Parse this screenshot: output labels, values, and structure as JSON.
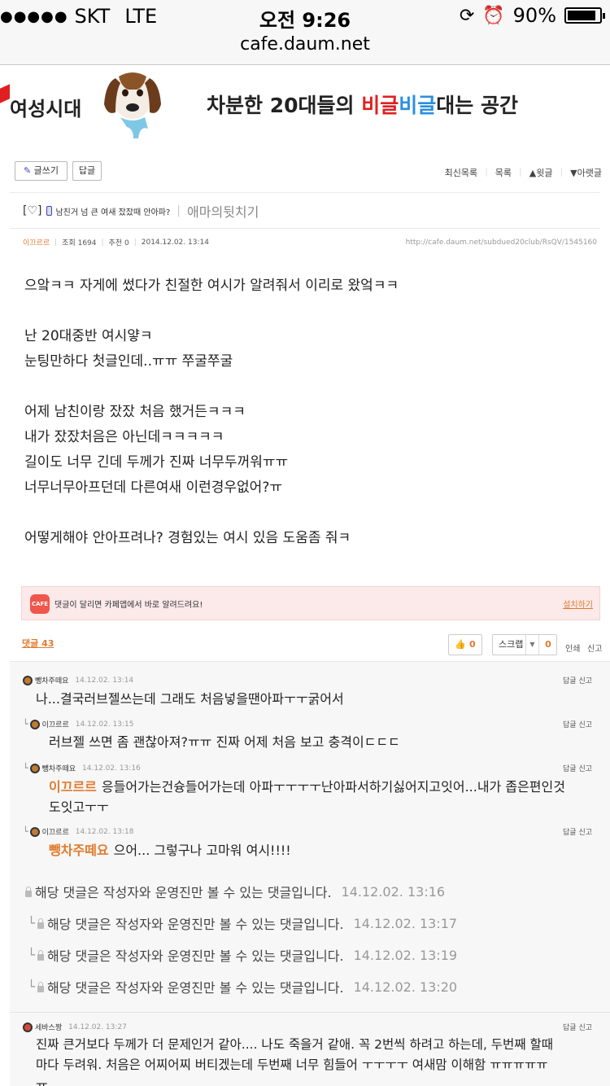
{
  "status": {
    "signal": "●●●●●",
    "carrier": "SKT",
    "network": "LTE",
    "time": "오전 9:26",
    "battery": "90%",
    "battery_level": 0.9
  },
  "url": "cafe.daum.net",
  "cafe": {
    "name": "여성시대",
    "slogan_1": "차분한 20대들의 ",
    "slogan_2": "비글",
    "slogan_3": "비글",
    "slogan_4": "대는 공간"
  },
  "toolbar": {
    "write": "글쓰기",
    "reply": "답글",
    "recent": "최신목록",
    "list": "목록",
    "prev": "▲윗글",
    "next": "▼아랫글"
  },
  "post": {
    "bracket": "[♡]",
    "title": "남친거 넘 큰 여새 잤잤때 안아파?",
    "category": "애마의뒷치기",
    "author": "이끄르르",
    "views": "조회 1694",
    "likes": "추천 0",
    "date": "2014.12.02. 13:14",
    "url": "http://cafe.daum.net/subdued20club/RsQV/1545160",
    "body": [
      "으앜ㅋㅋ 자게에 썼다가 친절한 여시가 알려줘서 이리로 왔엌ㅋㅋ",
      "",
      "난 20대중반 여시얗ㅋ",
      "눈팅만하다 첫글인데..ㅠㅠ 쭈굴쭈굴",
      "",
      "어제 남친이랑 잤잤 처음 했거든ㅋㅋㅋ",
      "내가 잤잤처음은 아닌데ㅋㅋㅋㅋㅋ",
      "길이도 너무 긴데 두께가 진짜 너무두꺼워ㅠㅠ",
      "너무너무아프던데 다른여새 이런경우없어?ㅠ",
      "",
      "어떻게해야 안아프려나? 경험있는 여시 있음 도움좀 줘ㅋ"
    ]
  },
  "app_banner": {
    "icon": "CAFE",
    "message": "댓글이 달리면 카페앱에서 바로 알려드려요!",
    "install": "설치하기"
  },
  "comment_bar": {
    "count": "댓글 43",
    "like_count": "0",
    "scrap": "스크랩",
    "scrap_count": "0",
    "print": "인쇄",
    "report": "신고"
  },
  "comments": [
    {
      "author": "뺑차주떼요",
      "time": "14.12.02. 13:14",
      "text": "나...결국러브젤쓰는데 그래도 처음넣을땐아파ㅜㅜ굵어서",
      "mention": "",
      "reply_label": "답글",
      "report_label": "신고"
    },
    {
      "author": "이끄르르",
      "time": "14.12.02. 13:15",
      "text": "러브젤 쓰면 좀 괜찮아져?ㅠㅠ 진짜 어제 처음 보고 충격이ㄷㄷㄷ",
      "mention": "",
      "reply_label": "답글",
      "report_label": "신고"
    },
    {
      "author": "뺑차주떼요",
      "time": "14.12.02. 13:16",
      "text_1": "응들어가는건슝들어가는데 아파ㅜㅜㅜㅜ난아파서하기싫어지고잇어...내가 좁은편인것",
      "text_2": "도잇고ㅜㅜ",
      "mention": "이끄르르",
      "reply_label": "답글",
      "report_label": "신고"
    },
    {
      "author": "이끄르르",
      "time": "14.12.02. 13:18",
      "text": "으어... 그렇구나 고마워 여시!!!!",
      "mention": "뺑차주떼요",
      "reply_label": "답글",
      "report_label": "신고"
    }
  ],
  "hidden_comments": [
    {
      "prefix": "",
      "text": "해당 댓글은 작성자와 운영진만 볼 수 있는 댓글입니다.",
      "time": "14.12.02. 13:16"
    },
    {
      "prefix": "└",
      "text": "해당 댓글은 작성자와 운영진만 볼 수 있는 댓글입니다.",
      "time": "14.12.02. 13:17"
    },
    {
      "prefix": "└",
      "text": "해당 댓글은 작성자와 운영진만 볼 수 있는 댓글입니다.",
      "time": "14.12.02. 13:19"
    },
    {
      "prefix": "└",
      "text": "해당 댓글은 작성자와 운영진만 볼 수 있는 댓글입니다.",
      "time": "14.12.02. 13:20"
    }
  ],
  "last_comment": {
    "author": "세바스짱",
    "time": "14.12.02. 13:27",
    "line_1": "진짜 큰거보다 두께가 더 문제인거 같아.... 나도 죽을거 같애. 꼭 2번씩 하려고 하는데, 두번째 할때",
    "line_2": "마다 두려워. 처음은 어찌어찌 버티겠는데 두번째 너무 힘들어 ㅜㅜㅜㅜ 여새맘 이해함 ㅠㅠㅠㅠㅠ",
    "line_3": "ㅠ",
    "reply_label": "답글",
    "report_label": "신고"
  }
}
